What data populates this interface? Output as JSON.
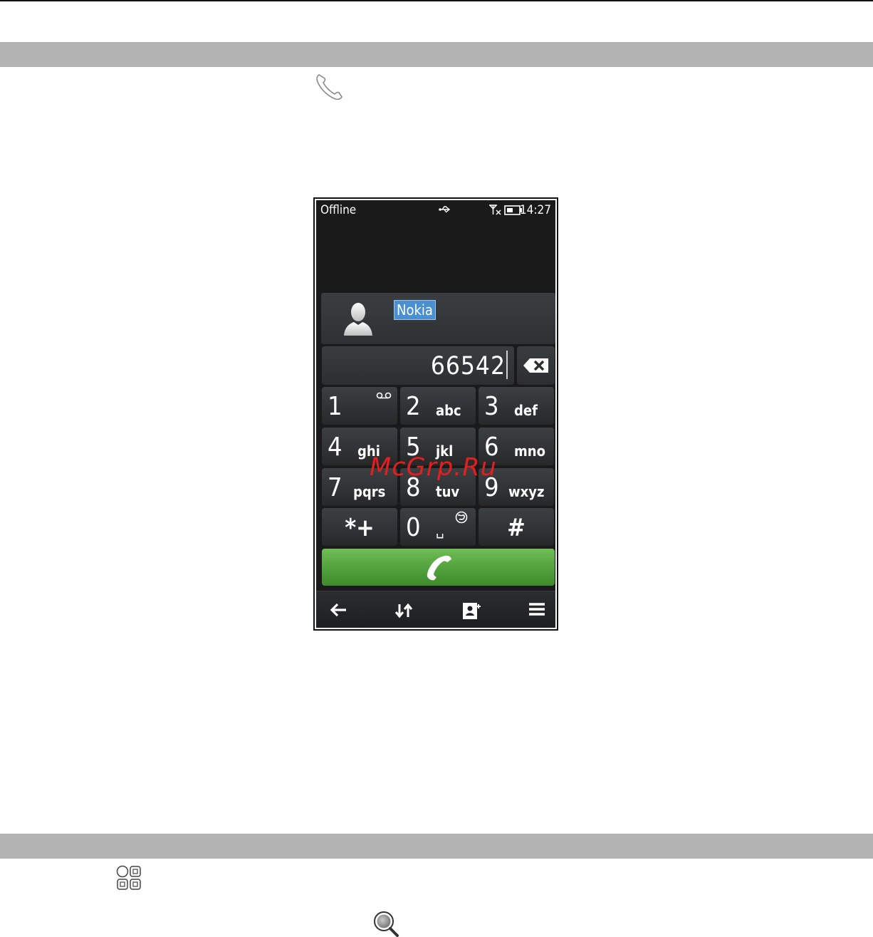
{
  "status_bar": {
    "network": "Offline",
    "time": "14:27"
  },
  "contact": {
    "name": "Nokia"
  },
  "number_field": {
    "value": "66542"
  },
  "keypad": [
    {
      "digit": "1",
      "letters": "",
      "icon": "voicemail-icon"
    },
    {
      "digit": "2",
      "letters": "abc"
    },
    {
      "digit": "3",
      "letters": "def"
    },
    {
      "digit": "4",
      "letters": "ghi"
    },
    {
      "digit": "5",
      "letters": "jkl"
    },
    {
      "digit": "6",
      "letters": "mno"
    },
    {
      "digit": "7",
      "letters": "pqrs"
    },
    {
      "digit": "8",
      "letters": "tuv"
    },
    {
      "digit": "9",
      "letters": "wxyz"
    },
    {
      "digit": "*+",
      "letters": ""
    },
    {
      "digit": "0",
      "letters": "␣",
      "icon": "globe-icon"
    },
    {
      "digit": "#",
      "letters": ""
    }
  ],
  "toolbar": [
    "back-icon",
    "switch-icon",
    "contacts-icon",
    "menu-icon"
  ],
  "watermark": "McGrp.Ru",
  "colors": {
    "call_green": "#55a83f",
    "highlight_blue": "#4a8fd0",
    "band_gray": "#b3b3b3"
  }
}
